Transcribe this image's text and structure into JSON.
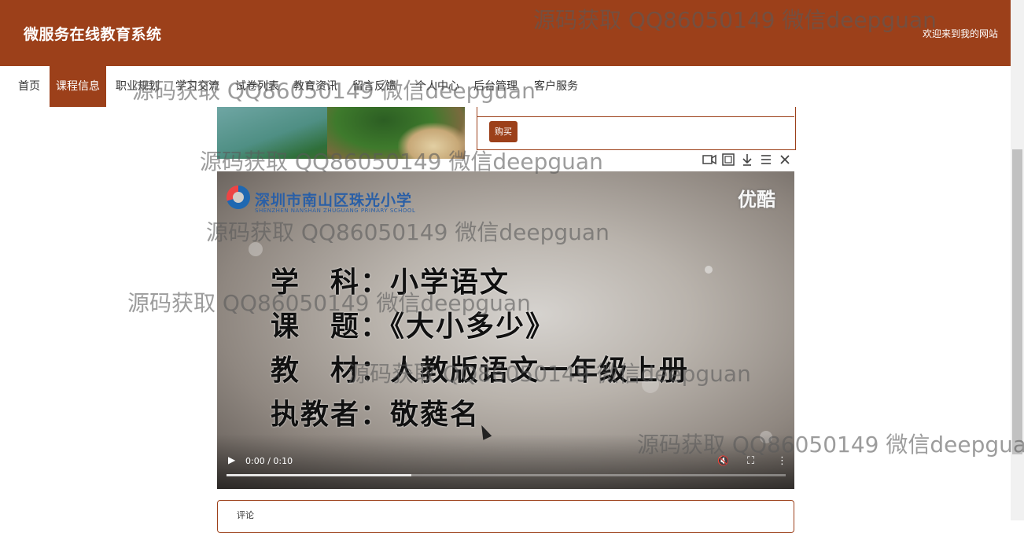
{
  "header": {
    "site_title": "微服务在线教育系统",
    "welcome": "欢迎来到我的网站",
    "bg_color": "#9c401a"
  },
  "nav": {
    "items": [
      {
        "label": "首页",
        "active": false
      },
      {
        "label": "课程信息",
        "active": true
      },
      {
        "label": "职业规划",
        "active": false
      },
      {
        "label": "学习交流",
        "active": false
      },
      {
        "label": "试卷列表",
        "active": false
      },
      {
        "label": "教育资讯",
        "active": false
      },
      {
        "label": "留言反馈",
        "active": false
      },
      {
        "label": "个人中心",
        "active": false
      },
      {
        "label": "后台管理",
        "active": false
      },
      {
        "label": "客户服务",
        "active": false
      }
    ]
  },
  "product": {
    "buy_label": "购买"
  },
  "video": {
    "school_name": "深圳市南山区珠光小学",
    "school_name_en": "SHENZHEN NANSHAN ZHUGUANG PRIMARY SCHOOL",
    "brand": "优酷",
    "lines": [
      "学　科：小学语文",
      "课　题：《大小多少》",
      "教　材：人教版语文一年级上册",
      "执教者：敬蕤名"
    ],
    "time": "0:00 / 0:10",
    "progress": 0.33,
    "play_icon": "▶",
    "volume_icon": "🔇",
    "fullscreen_icon": "⛶",
    "more_icon": "⋮"
  },
  "toolbar": {
    "icons": [
      "camera-icon",
      "expand-icon",
      "download-icon",
      "menu-icon",
      "close-icon"
    ]
  },
  "comment": {
    "label": "评论"
  },
  "watermark": {
    "text": "源码获取 QQ86050149 微信deepguan"
  }
}
